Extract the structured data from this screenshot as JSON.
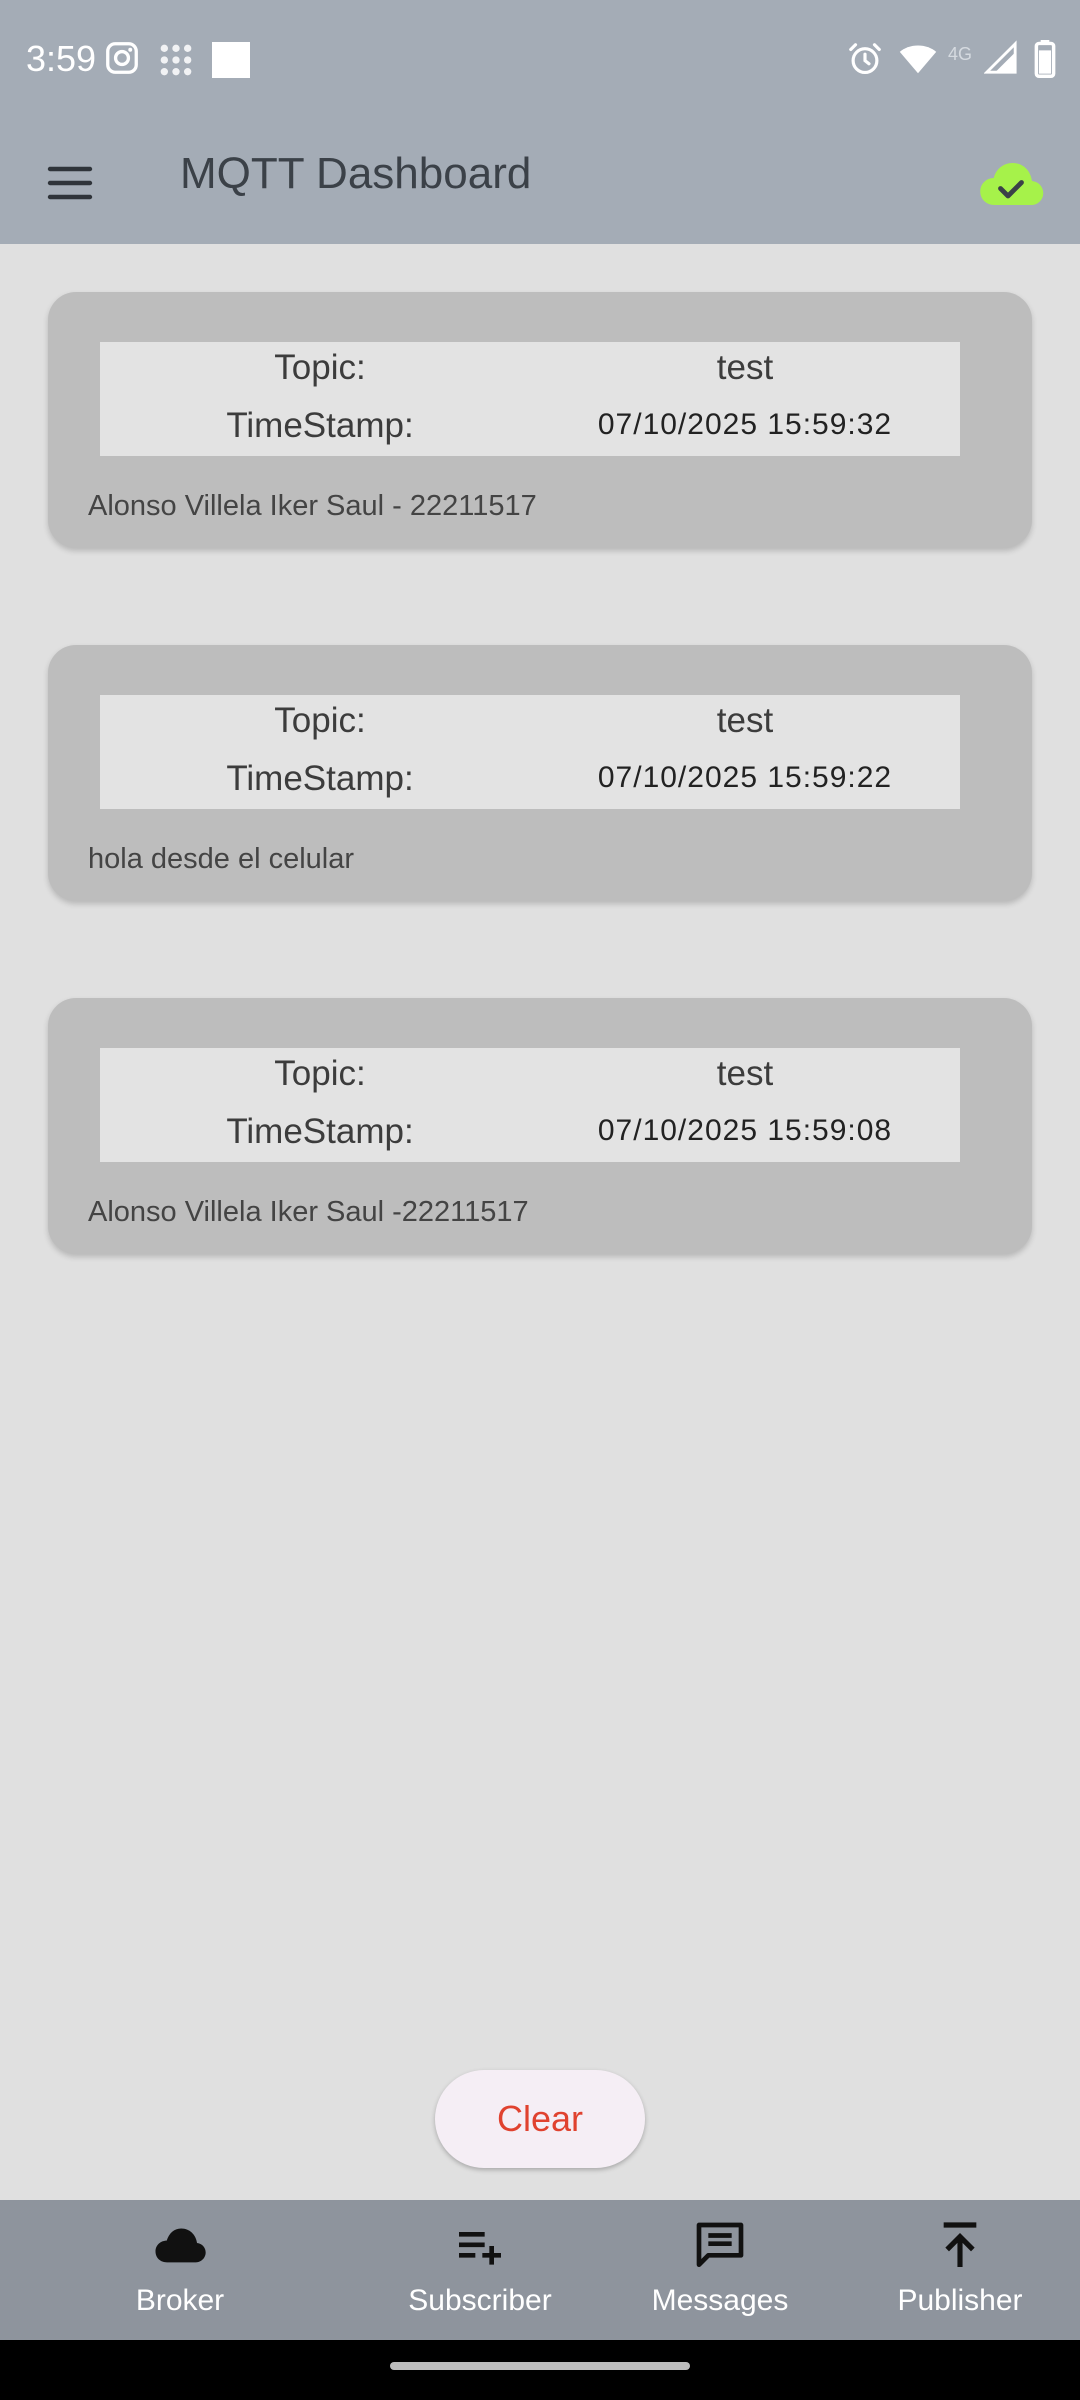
{
  "status_bar": {
    "time": "3:59",
    "icons": [
      "instagram-icon",
      "apps-grid-icon",
      "white-square-icon",
      "alarm-icon",
      "wifi-icon",
      "4g-icon",
      "signal-icon",
      "battery-icon"
    ],
    "network": "4G"
  },
  "app_bar": {
    "title": "MQTT Dashboard",
    "menu_icon": "hamburger-menu-icon",
    "status_icon": "cloud-check-icon",
    "status_color": "#a6f24a"
  },
  "messages": [
    {
      "topic_label": "Topic:",
      "topic": "test",
      "timestamp_label": "TimeStamp:",
      "timestamp": "07/10/2025 15:59:32",
      "body": "Alonso Villela Iker Saul - 22211517"
    },
    {
      "topic_label": "Topic:",
      "topic": "test",
      "timestamp_label": "TimeStamp:",
      "timestamp": "07/10/2025 15:59:22",
      "body": "hola desde el celular"
    },
    {
      "topic_label": "Topic:",
      "topic": "test",
      "timestamp_label": "TimeStamp:",
      "timestamp": "07/10/2025 15:59:08",
      "body": "Alonso Villela Iker Saul -22211517"
    }
  ],
  "clear_button": {
    "label": "Clear",
    "color": "#e0422f"
  },
  "bottom_nav": [
    {
      "label": "Broker",
      "icon": "cloud-icon"
    },
    {
      "label": "Subscriber",
      "icon": "playlist-add-icon"
    },
    {
      "label": "Messages",
      "icon": "message-icon"
    },
    {
      "label": "Publisher",
      "icon": "publish-icon"
    }
  ]
}
